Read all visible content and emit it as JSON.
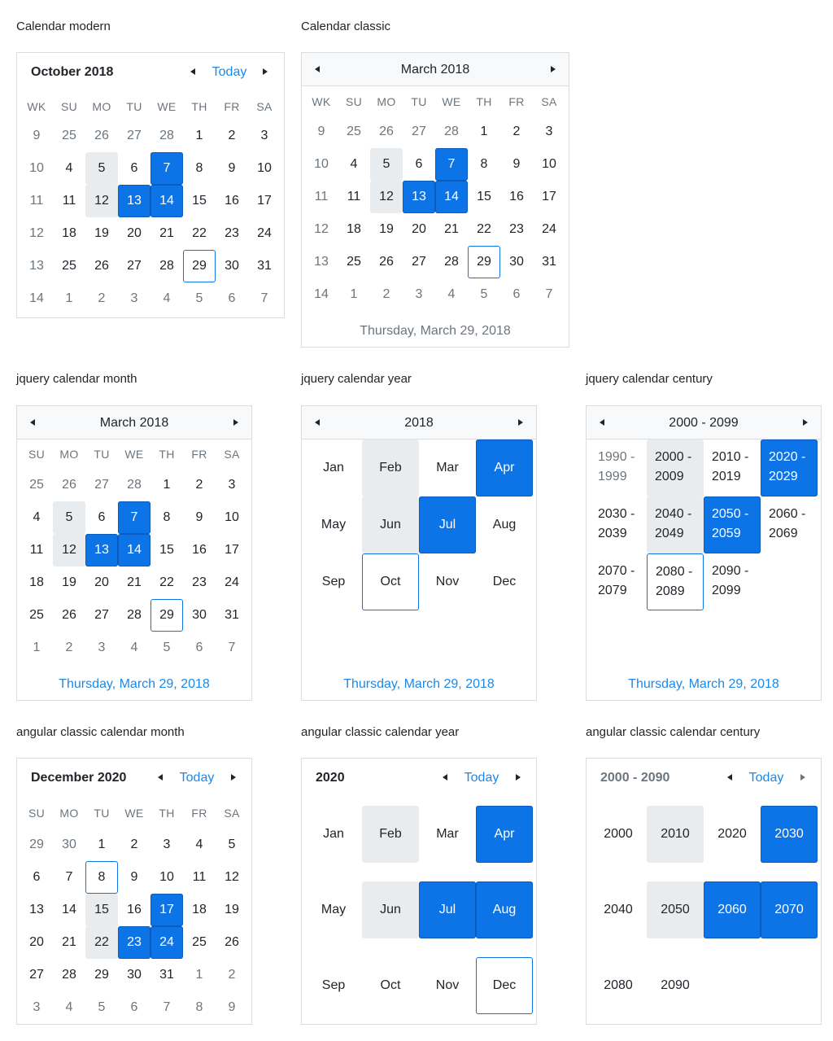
{
  "colors": {
    "accent": "#0d74e7",
    "link": "#1e88e5",
    "hover": "#e9ecef",
    "muted": "#6c757d",
    "border": "#dcdcdc"
  },
  "icons": {
    "prev": "caret-left-icon",
    "next": "caret-right-icon"
  },
  "titles": {
    "modern": "Calendar modern",
    "classic": "Calendar classic",
    "jq_month": "jquery calendar month",
    "jq_year": "jquery calendar year",
    "jq_century": "jquery calendar century",
    "ng_month": "angular classic calendar month",
    "ng_year": "angular classic calendar year",
    "ng_century": "angular classic calendar century"
  },
  "today_label": "Today",
  "footer_date": "Thursday, March 29, 2018",
  "week_header_wk": [
    "WK",
    "SU",
    "MO",
    "TU",
    "WE",
    "TH",
    "FR",
    "SA"
  ],
  "week_header": [
    "SU",
    "MO",
    "TU",
    "WE",
    "TH",
    "FR",
    "SA"
  ],
  "modern": {
    "month_label": "October 2018",
    "rows": [
      [
        "9",
        "25",
        "26",
        "27",
        "28",
        "1",
        "2",
        "3"
      ],
      [
        "10",
        "4",
        "5",
        "6",
        "7",
        "8",
        "9",
        "10"
      ],
      [
        "11",
        "11",
        "12",
        "13",
        "14",
        "15",
        "16",
        "17"
      ],
      [
        "12",
        "18",
        "19",
        "20",
        "21",
        "22",
        "23",
        "24"
      ],
      [
        "13",
        "25",
        "26",
        "27",
        "28",
        "29",
        "30",
        "31"
      ],
      [
        "14",
        "1",
        "2",
        "3",
        "4",
        "5",
        "6",
        "7"
      ]
    ]
  },
  "classic": {
    "month_label": "March 2018",
    "rows": [
      [
        "9",
        "25",
        "26",
        "27",
        "28",
        "1",
        "2",
        "3"
      ],
      [
        "10",
        "4",
        "5",
        "6",
        "7",
        "8",
        "9",
        "10"
      ],
      [
        "11",
        "11",
        "12",
        "13",
        "14",
        "15",
        "16",
        "17"
      ],
      [
        "12",
        "18",
        "19",
        "20",
        "21",
        "22",
        "23",
        "24"
      ],
      [
        "13",
        "25",
        "26",
        "27",
        "28",
        "29",
        "30",
        "31"
      ],
      [
        "14",
        "1",
        "2",
        "3",
        "4",
        "5",
        "6",
        "7"
      ]
    ]
  },
  "jq_month": {
    "month_label": "March 2018",
    "rows": [
      [
        "25",
        "26",
        "27",
        "28",
        "1",
        "2",
        "3"
      ],
      [
        "4",
        "5",
        "6",
        "7",
        "8",
        "9",
        "10"
      ],
      [
        "11",
        "12",
        "13",
        "14",
        "15",
        "16",
        "17"
      ],
      [
        "18",
        "19",
        "20",
        "21",
        "22",
        "23",
        "24"
      ],
      [
        "25",
        "26",
        "27",
        "28",
        "29",
        "30",
        "31"
      ],
      [
        "1",
        "2",
        "3",
        "4",
        "5",
        "6",
        "7"
      ]
    ]
  },
  "jq_year": {
    "label": "2018",
    "cells": [
      "Jan",
      "Feb",
      "Mar",
      "Apr",
      "May",
      "Jun",
      "Jul",
      "Aug",
      "Sep",
      "Oct",
      "Nov",
      "Dec"
    ]
  },
  "jq_century": {
    "label": "2000 - 2099",
    "cells": [
      [
        "1990 -",
        "1999"
      ],
      [
        "2000 -",
        "2009"
      ],
      [
        "2010 -",
        "2019"
      ],
      [
        "2020 -",
        "2029"
      ],
      [
        "2030 -",
        "2039"
      ],
      [
        "2040 -",
        "2049"
      ],
      [
        "2050 -",
        "2059"
      ],
      [
        "2060 -",
        "2069"
      ],
      [
        "2070 -",
        "2079"
      ],
      [
        "2080 -",
        "2089"
      ],
      [
        "2090 -",
        "2099"
      ]
    ]
  },
  "ng_month": {
    "month_label": "December 2020",
    "rows": [
      [
        "29",
        "30",
        "1",
        "2",
        "3",
        "4",
        "5"
      ],
      [
        "6",
        "7",
        "8",
        "9",
        "10",
        "11",
        "12"
      ],
      [
        "13",
        "14",
        "15",
        "16",
        "17",
        "18",
        "19"
      ],
      [
        "20",
        "21",
        "22",
        "23",
        "24",
        "25",
        "26"
      ],
      [
        "27",
        "28",
        "29",
        "30",
        "31",
        "1",
        "2"
      ],
      [
        "3",
        "4",
        "5",
        "6",
        "7",
        "8",
        "9"
      ]
    ]
  },
  "ng_year": {
    "label": "2020",
    "cells": [
      "Jan",
      "Feb",
      "Mar",
      "Apr",
      "May",
      "Jun",
      "Jul",
      "Aug",
      "Sep",
      "Oct",
      "Nov",
      "Dec"
    ]
  },
  "ng_century": {
    "label": "2000 - 2090",
    "cells": [
      "2000",
      "2010",
      "2020",
      "2030",
      "2040",
      "2050",
      "2060",
      "2070",
      "2080",
      "2090"
    ]
  }
}
